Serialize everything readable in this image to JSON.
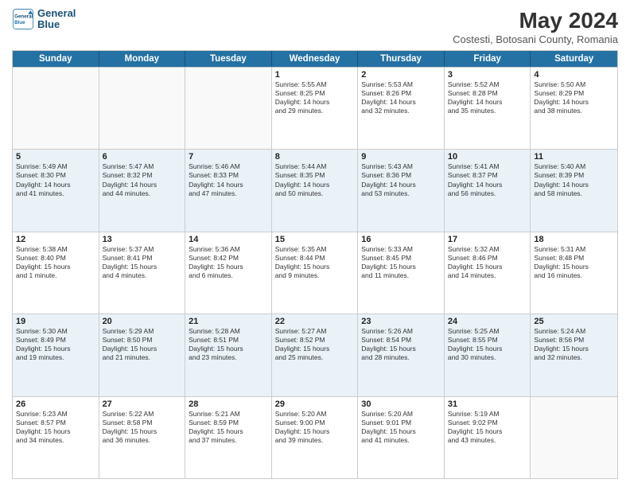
{
  "header": {
    "logo_line1": "General",
    "logo_line2": "Blue",
    "title": "May 2024",
    "subtitle": "Costesti, Botosani County, Romania"
  },
  "weekdays": [
    "Sunday",
    "Monday",
    "Tuesday",
    "Wednesday",
    "Thursday",
    "Friday",
    "Saturday"
  ],
  "weeks": [
    [
      {
        "day": "",
        "info": ""
      },
      {
        "day": "",
        "info": ""
      },
      {
        "day": "",
        "info": ""
      },
      {
        "day": "1",
        "info": "Sunrise: 5:55 AM\nSunset: 8:25 PM\nDaylight: 14 hours\nand 29 minutes."
      },
      {
        "day": "2",
        "info": "Sunrise: 5:53 AM\nSunset: 8:26 PM\nDaylight: 14 hours\nand 32 minutes."
      },
      {
        "day": "3",
        "info": "Sunrise: 5:52 AM\nSunset: 8:28 PM\nDaylight: 14 hours\nand 35 minutes."
      },
      {
        "day": "4",
        "info": "Sunrise: 5:50 AM\nSunset: 8:29 PM\nDaylight: 14 hours\nand 38 minutes."
      }
    ],
    [
      {
        "day": "5",
        "info": "Sunrise: 5:49 AM\nSunset: 8:30 PM\nDaylight: 14 hours\nand 41 minutes."
      },
      {
        "day": "6",
        "info": "Sunrise: 5:47 AM\nSunset: 8:32 PM\nDaylight: 14 hours\nand 44 minutes."
      },
      {
        "day": "7",
        "info": "Sunrise: 5:46 AM\nSunset: 8:33 PM\nDaylight: 14 hours\nand 47 minutes."
      },
      {
        "day": "8",
        "info": "Sunrise: 5:44 AM\nSunset: 8:35 PM\nDaylight: 14 hours\nand 50 minutes."
      },
      {
        "day": "9",
        "info": "Sunrise: 5:43 AM\nSunset: 8:36 PM\nDaylight: 14 hours\nand 53 minutes."
      },
      {
        "day": "10",
        "info": "Sunrise: 5:41 AM\nSunset: 8:37 PM\nDaylight: 14 hours\nand 56 minutes."
      },
      {
        "day": "11",
        "info": "Sunrise: 5:40 AM\nSunset: 8:39 PM\nDaylight: 14 hours\nand 58 minutes."
      }
    ],
    [
      {
        "day": "12",
        "info": "Sunrise: 5:38 AM\nSunset: 8:40 PM\nDaylight: 15 hours\nand 1 minute."
      },
      {
        "day": "13",
        "info": "Sunrise: 5:37 AM\nSunset: 8:41 PM\nDaylight: 15 hours\nand 4 minutes."
      },
      {
        "day": "14",
        "info": "Sunrise: 5:36 AM\nSunset: 8:42 PM\nDaylight: 15 hours\nand 6 minutes."
      },
      {
        "day": "15",
        "info": "Sunrise: 5:35 AM\nSunset: 8:44 PM\nDaylight: 15 hours\nand 9 minutes."
      },
      {
        "day": "16",
        "info": "Sunrise: 5:33 AM\nSunset: 8:45 PM\nDaylight: 15 hours\nand 11 minutes."
      },
      {
        "day": "17",
        "info": "Sunrise: 5:32 AM\nSunset: 8:46 PM\nDaylight: 15 hours\nand 14 minutes."
      },
      {
        "day": "18",
        "info": "Sunrise: 5:31 AM\nSunset: 8:48 PM\nDaylight: 15 hours\nand 16 minutes."
      }
    ],
    [
      {
        "day": "19",
        "info": "Sunrise: 5:30 AM\nSunset: 8:49 PM\nDaylight: 15 hours\nand 19 minutes."
      },
      {
        "day": "20",
        "info": "Sunrise: 5:29 AM\nSunset: 8:50 PM\nDaylight: 15 hours\nand 21 minutes."
      },
      {
        "day": "21",
        "info": "Sunrise: 5:28 AM\nSunset: 8:51 PM\nDaylight: 15 hours\nand 23 minutes."
      },
      {
        "day": "22",
        "info": "Sunrise: 5:27 AM\nSunset: 8:52 PM\nDaylight: 15 hours\nand 25 minutes."
      },
      {
        "day": "23",
        "info": "Sunrise: 5:26 AM\nSunset: 8:54 PM\nDaylight: 15 hours\nand 28 minutes."
      },
      {
        "day": "24",
        "info": "Sunrise: 5:25 AM\nSunset: 8:55 PM\nDaylight: 15 hours\nand 30 minutes."
      },
      {
        "day": "25",
        "info": "Sunrise: 5:24 AM\nSunset: 8:56 PM\nDaylight: 15 hours\nand 32 minutes."
      }
    ],
    [
      {
        "day": "26",
        "info": "Sunrise: 5:23 AM\nSunset: 8:57 PM\nDaylight: 15 hours\nand 34 minutes."
      },
      {
        "day": "27",
        "info": "Sunrise: 5:22 AM\nSunset: 8:58 PM\nDaylight: 15 hours\nand 36 minutes."
      },
      {
        "day": "28",
        "info": "Sunrise: 5:21 AM\nSunset: 8:59 PM\nDaylight: 15 hours\nand 37 minutes."
      },
      {
        "day": "29",
        "info": "Sunrise: 5:20 AM\nSunset: 9:00 PM\nDaylight: 15 hours\nand 39 minutes."
      },
      {
        "day": "30",
        "info": "Sunrise: 5:20 AM\nSunset: 9:01 PM\nDaylight: 15 hours\nand 41 minutes."
      },
      {
        "day": "31",
        "info": "Sunrise: 5:19 AM\nSunset: 9:02 PM\nDaylight: 15 hours\nand 43 minutes."
      },
      {
        "day": "",
        "info": ""
      }
    ]
  ],
  "alt_rows": [
    1,
    3
  ]
}
